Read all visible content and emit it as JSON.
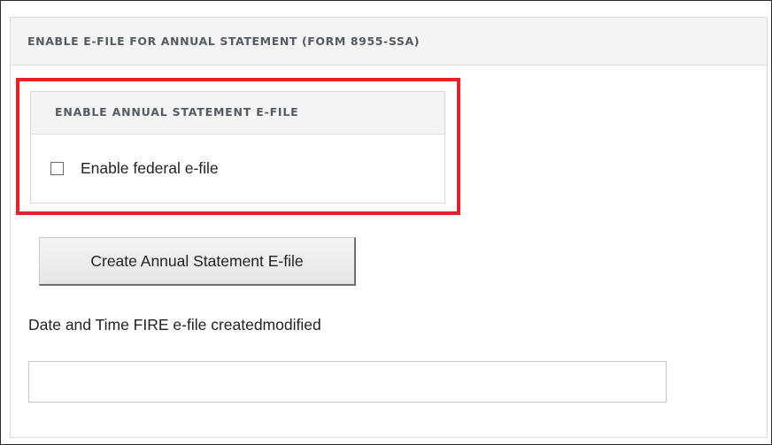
{
  "panel": {
    "title": "ENABLE E-FILE FOR ANNUAL STATEMENT (FORM 8955-SSA)"
  },
  "subpanel": {
    "title": "ENABLE ANNUAL STATEMENT E-FILE",
    "checkbox_label": "Enable federal e-file",
    "checked": false
  },
  "actions": {
    "create_button_label": "Create Annual Statement E-file"
  },
  "fire_field": {
    "label": "Date and Time FIRE e-file createdmodified",
    "value": ""
  },
  "colors": {
    "highlight": "#e8202a",
    "header_bg": "#f4f4f4",
    "header_text": "#555a63"
  }
}
